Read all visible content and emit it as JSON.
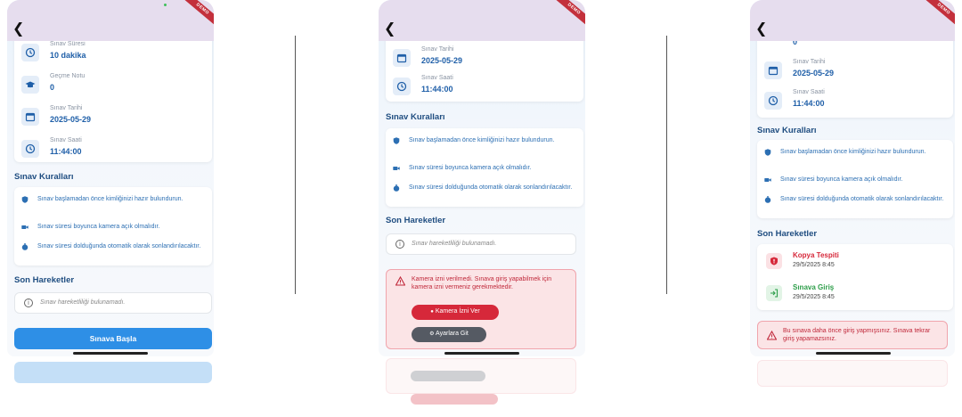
{
  "back_icon": "chevron-left-icon",
  "badge": "DEMO",
  "exam_info": {
    "duration_label": "Sınav Süresi",
    "duration_value": "10 dakika",
    "pass_label": "Geçme Notu",
    "pass_value": "0",
    "date_label": "Sınav Tarihi",
    "date_value": "2025-05-29",
    "time_label": "Sınav Saati",
    "time_value": "11:44:00"
  },
  "rules": {
    "title": "Sınav Kuralları",
    "items": [
      {
        "icon": "shield-check-icon",
        "text": "Sınav başlamadan önce kimliğinizi hazır bulundurun."
      },
      {
        "icon": "camera-icon",
        "text": "Sınav süresi boyunca kamera açık olmalıdır."
      },
      {
        "icon": "timer-icon",
        "text": "Sınav süresi dolduğunda otomatik olarak sonlandırılacaktır."
      }
    ]
  },
  "recent": {
    "title": "Son Hareketler",
    "empty_text": "Sınav hareketliliği bulunamadı."
  },
  "start_button": "Sınava Başla",
  "camera_alert": {
    "text": "Kamera izni verilmedi. Sınava giriş yapabilmek için kamera izni vermeniz gerekmektedir.",
    "grant_button": "Kamera İzni Ver",
    "settings_button": "Ayarlara Git"
  },
  "activities": [
    {
      "icon": "shield-alert-icon",
      "title": "Kopya Tespiti",
      "time": "29/5/2025 8:45",
      "color": "#d6283a"
    },
    {
      "icon": "login-icon",
      "title": "Sınava Giriş",
      "time": "29/5/2025 8:45",
      "color": "#2e9e4a"
    }
  ],
  "already_entered_alert": "Bu sınava daha önce giriş yapmışsınız. Sınava tekrar giriş yapamazsınız.",
  "colors": {
    "primary": "#2e8fe6",
    "appbar": "#e6ddee",
    "danger": "#d6283a",
    "success": "#2e9e4a",
    "value": "#1f5fa8"
  }
}
